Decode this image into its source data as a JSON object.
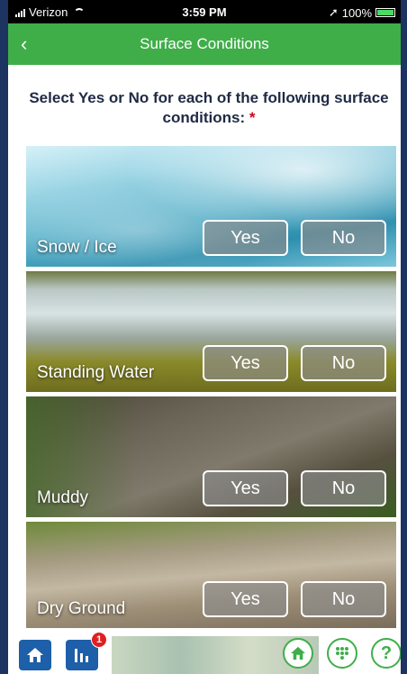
{
  "status_bar": {
    "carrier": "Verizon",
    "time": "3:59 PM",
    "battery": "100%"
  },
  "header": {
    "title": "Surface Conditions",
    "back_icon": "chevron-left-icon"
  },
  "prompt": {
    "text": "Select Yes or No for each of the following surface conditions:",
    "required_mark": "*"
  },
  "conditions": [
    {
      "label": "Snow / Ice",
      "yes_label": "Yes",
      "no_label": "No"
    },
    {
      "label": "Standing Water",
      "yes_label": "Yes",
      "no_label": "No"
    },
    {
      "label": "Muddy",
      "yes_label": "Yes",
      "no_label": "No"
    },
    {
      "label": "Dry Ground",
      "yes_label": "Yes",
      "no_label": "No"
    }
  ],
  "bottom_bar": {
    "notification_count": "1",
    "help_label": "?"
  },
  "colors": {
    "header_green": "#3fae49",
    "tab_blue": "#1d5fa8",
    "badge_red": "#e02020"
  }
}
